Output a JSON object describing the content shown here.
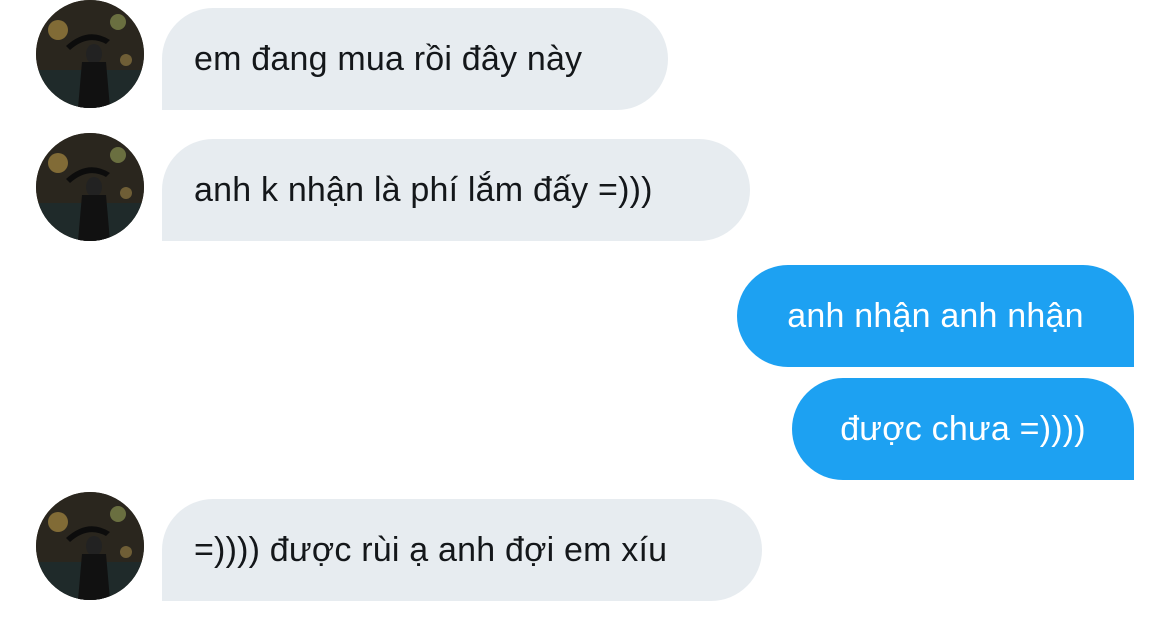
{
  "conversation": {
    "messages": [
      {
        "sender": "contact",
        "text": "em đang mua rồi đây này"
      },
      {
        "sender": "contact",
        "text": "anh k nhận là phí lắm đấy =)))"
      },
      {
        "sender": "me",
        "text": "anh nhận anh nhận"
      },
      {
        "sender": "me",
        "text": "được chưa =))))"
      },
      {
        "sender": "contact",
        "text": "=)))) được rùi ạ anh đợi em xíu"
      }
    ]
  },
  "colors": {
    "incoming_bubble": "#e7ecf0",
    "outgoing_bubble": "#1da1f2",
    "incoming_text": "#14171a",
    "outgoing_text": "#ffffff"
  },
  "icons": {
    "contact_avatar": "person-with-umbrella-photo"
  }
}
